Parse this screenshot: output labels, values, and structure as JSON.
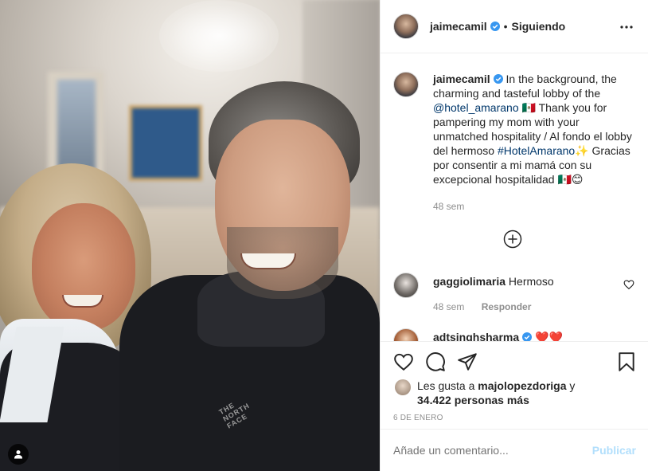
{
  "post": {
    "author": "jaimecamil",
    "follow_status": "Siguiendo",
    "separator": "•",
    "caption_prefix": "In the background, the charming and tasteful lobby of the ",
    "caption_mention": "@hotel_amarano",
    "caption_mid": " 🇲🇽 Thank you for pampering my mom with your unmatched hospitality / Al fondo el lobby del hermoso ",
    "caption_hashtag": "#HotelAmarano",
    "caption_suffix": "✨ Gracias por consentir a mi mamá con su excepcional hospitalidad 🇲🇽😊",
    "caption_age": "48 sem",
    "brand_logo_text": [
      "THE",
      "NORTH",
      "FACE"
    ]
  },
  "comments": [
    {
      "user": "gaggiolimaria",
      "text": "Hermoso",
      "age": "48 sem",
      "reply_label": "Responder"
    },
    {
      "user": "adtsinghsharma",
      "text": "❤️❤️",
      "verified": true
    }
  ],
  "likes": {
    "prefix": "Les gusta a ",
    "user": "majolopezdoriga",
    "suffix": " y",
    "others": "34.422 personas más"
  },
  "date": "6 DE ENERO",
  "add_comment": {
    "placeholder": "Añade un comentario...",
    "publish_label": "Publicar"
  },
  "colors": {
    "verified_blue": "#3897f0",
    "link": "#00376b",
    "publish_disabled": "#b2dffc",
    "muted": "#8e8e8e"
  }
}
